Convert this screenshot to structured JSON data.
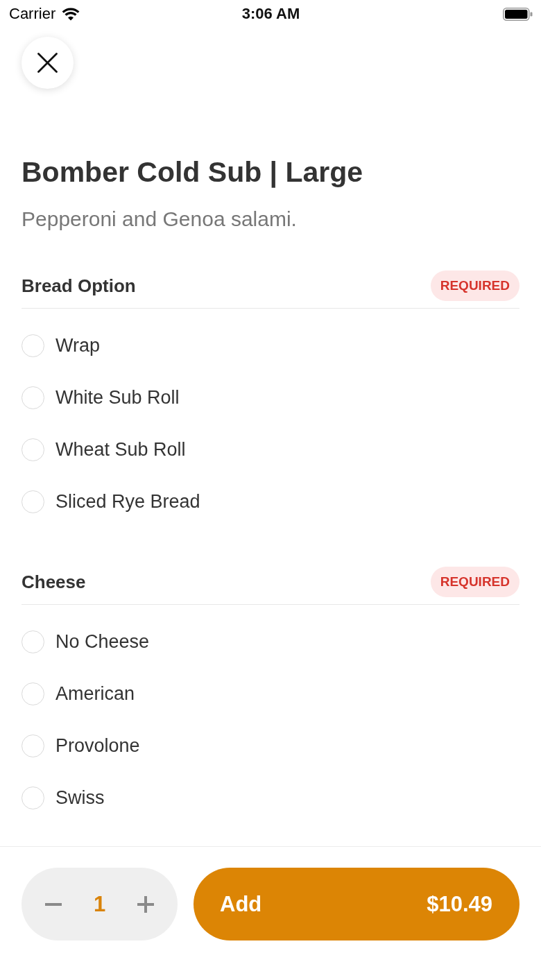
{
  "status_bar": {
    "carrier": "Carrier",
    "time": "3:06 AM"
  },
  "item": {
    "title": "Bomber Cold Sub | Large",
    "description": "Pepperoni and Genoa salami."
  },
  "option_groups": [
    {
      "title": "Bread Option",
      "badge": "REQUIRED",
      "options": [
        {
          "label": "Wrap",
          "selected": false
        },
        {
          "label": "White Sub Roll",
          "selected": false
        },
        {
          "label": "Wheat Sub Roll",
          "selected": false
        },
        {
          "label": "Sliced Rye Bread",
          "selected": false
        }
      ]
    },
    {
      "title": "Cheese",
      "badge": "REQUIRED",
      "options": [
        {
          "label": "No Cheese",
          "selected": false
        },
        {
          "label": "American",
          "selected": false
        },
        {
          "label": "Provolone",
          "selected": false
        },
        {
          "label": "Swiss",
          "selected": false
        }
      ]
    }
  ],
  "footer": {
    "quantity": "1",
    "add_button": {
      "label": "Add",
      "price": "$10.49"
    }
  }
}
